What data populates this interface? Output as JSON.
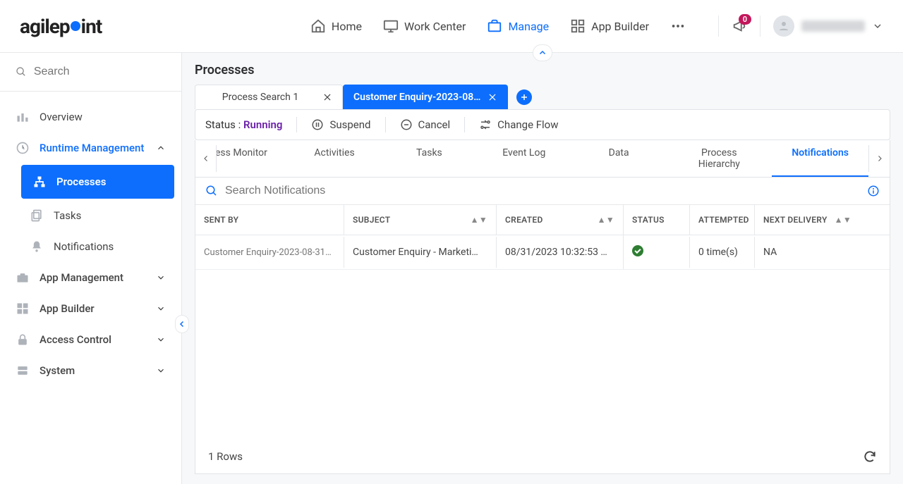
{
  "header": {
    "logo": "agilepoint",
    "nav": {
      "home": "Home",
      "work_center": "Work Center",
      "manage": "Manage",
      "app_builder": "App Builder"
    },
    "notif_badge": "0"
  },
  "sidebar": {
    "search_placeholder": "Search",
    "items": {
      "overview": "Overview",
      "runtime": "Runtime Management",
      "processes": "Processes",
      "tasks": "Tasks",
      "notifications": "Notifications",
      "app_mgmt": "App Management",
      "app_builder": "App Builder",
      "access_ctrl": "Access Control",
      "system": "System"
    }
  },
  "page": {
    "title": "Processes"
  },
  "tabs": {
    "t1": "Process Search 1",
    "t2": "Customer Enquiry-2023-08…"
  },
  "toolbar": {
    "status_lbl": "Status :",
    "status_val": "Running",
    "suspend": "Suspend",
    "cancel": "Cancel",
    "change_flow": "Change Flow"
  },
  "subtabs": {
    "monitor": "ess Monitor",
    "activities": "Activities",
    "tasks": "Tasks",
    "event_log": "Event Log",
    "data": "Data",
    "hierarchy": "Process Hierarchy",
    "notifications": "Notifications"
  },
  "grid": {
    "search_placeholder": "Search Notifications",
    "cols": {
      "sent_by": "SENT BY",
      "subject": "SUBJECT",
      "created": "CREATED",
      "status": "STATUS",
      "attempted": "ATTEMPTED",
      "next_delivery": "NEXT DELIVERY"
    },
    "row": {
      "sent_by": "Customer Enquiry-2023-08-31T…",
      "subject": "Customer Enquiry - Marketi…",
      "created": "08/31/2023 10:32:53 …",
      "attempted": "0 time(s)",
      "next_delivery": "NA"
    },
    "footer": "1 Rows"
  }
}
